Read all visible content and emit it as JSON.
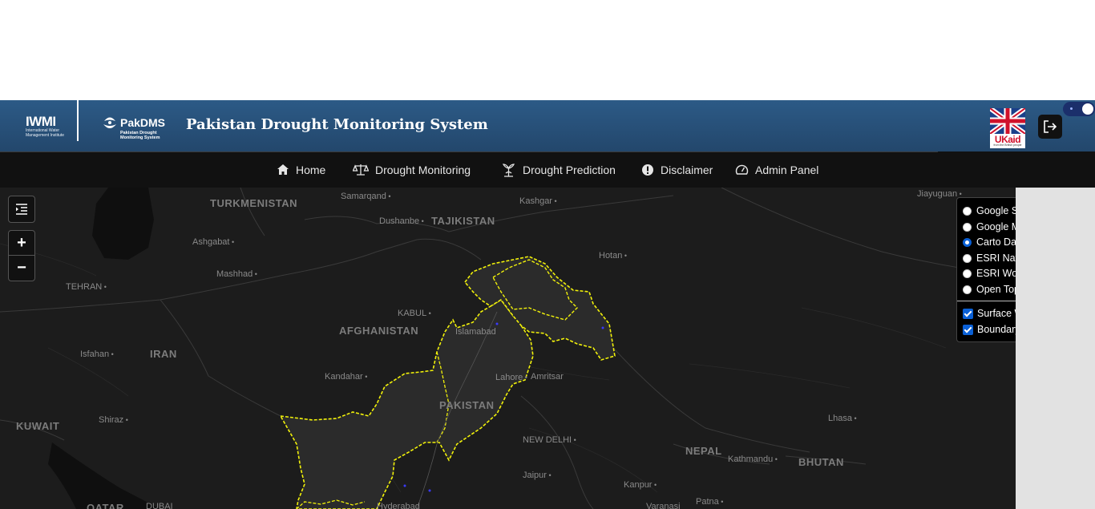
{
  "header": {
    "iwmi_logo": "IWMI",
    "iwmi_subtitle": "International Water Management Institute",
    "pakdms_brand": "PakDMS",
    "pakdms_subtitle": "Pakistan Drought Monitoring System",
    "title": "Pakistan Drought Monitoring System",
    "ukaid_text": "UKaid",
    "ukaid_tagline": "from the British people"
  },
  "nav": {
    "items": [
      {
        "label": "Home",
        "icon": "home-icon"
      },
      {
        "label": "Drought Monitoring",
        "icon": "scale-icon"
      },
      {
        "label": "Drought Prediction",
        "icon": "plant-icon"
      },
      {
        "label": "Disclaimer",
        "icon": "alert-circle-icon"
      },
      {
        "label": "Admin Panel",
        "icon": "dashboard-icon"
      }
    ]
  },
  "map": {
    "zoom_in": "+",
    "zoom_out": "−",
    "labels": {
      "turkmenistan": "TURKMENISTAN",
      "tajikistan": "TAJIKISTAN",
      "afghanistan": "AFGHANISTAN",
      "iran": "IRAN",
      "pakistan": "PAKISTAN",
      "kuwait": "KUWAIT",
      "nepal": "NEPAL",
      "bhutan": "BHUTAN",
      "qatar": "QATAR",
      "samarqand": "Samarqand",
      "dushanbe": "Dushanbe",
      "kashgar": "Kashgar",
      "jiayuguan": "Jiayuguan",
      "ashgabat": "Ashgabat",
      "hotan": "Hotan",
      "mashhad": "Mashhad",
      "tehran": "TEHRAN",
      "kabul": "KABUL",
      "islamabad": "Islamabad",
      "isfahan": "Isfahan",
      "kandahar": "Kandahar",
      "lahore": "Lahore",
      "amritsar": "Amritsar",
      "shiraz": "Shiraz",
      "lhasa": "Lhasa",
      "new_delhi": "NEW DELHI",
      "kathmandu": "Kathmandu",
      "jaipur": "Jaipur",
      "kanpur": "Kanpur",
      "patna": "Patna",
      "varanasi": "Varanasi",
      "dubai": "DUBAI",
      "karachi": "Hyderabad"
    }
  },
  "layer_panel": {
    "basemaps": [
      {
        "label": "Google Satellite",
        "selected": false
      },
      {
        "label": "Google Maps",
        "selected": false
      },
      {
        "label": "Carto Dark",
        "selected": true
      },
      {
        "label": "ESRI NatGeo",
        "selected": false
      },
      {
        "label": "ESRI World Imagery",
        "selected": false
      },
      {
        "label": "Open Topomap",
        "selected": false
      }
    ],
    "overlays": [
      {
        "label": "Surface Water",
        "checked": true
      },
      {
        "label": "Boundary",
        "checked": true
      }
    ]
  },
  "colors": {
    "header_bg": "#2c5a86",
    "nav_bg": "#111111",
    "map_bg": "#1c1c1c",
    "boundary": "#f2f20a",
    "accent": "#0a60d6"
  }
}
